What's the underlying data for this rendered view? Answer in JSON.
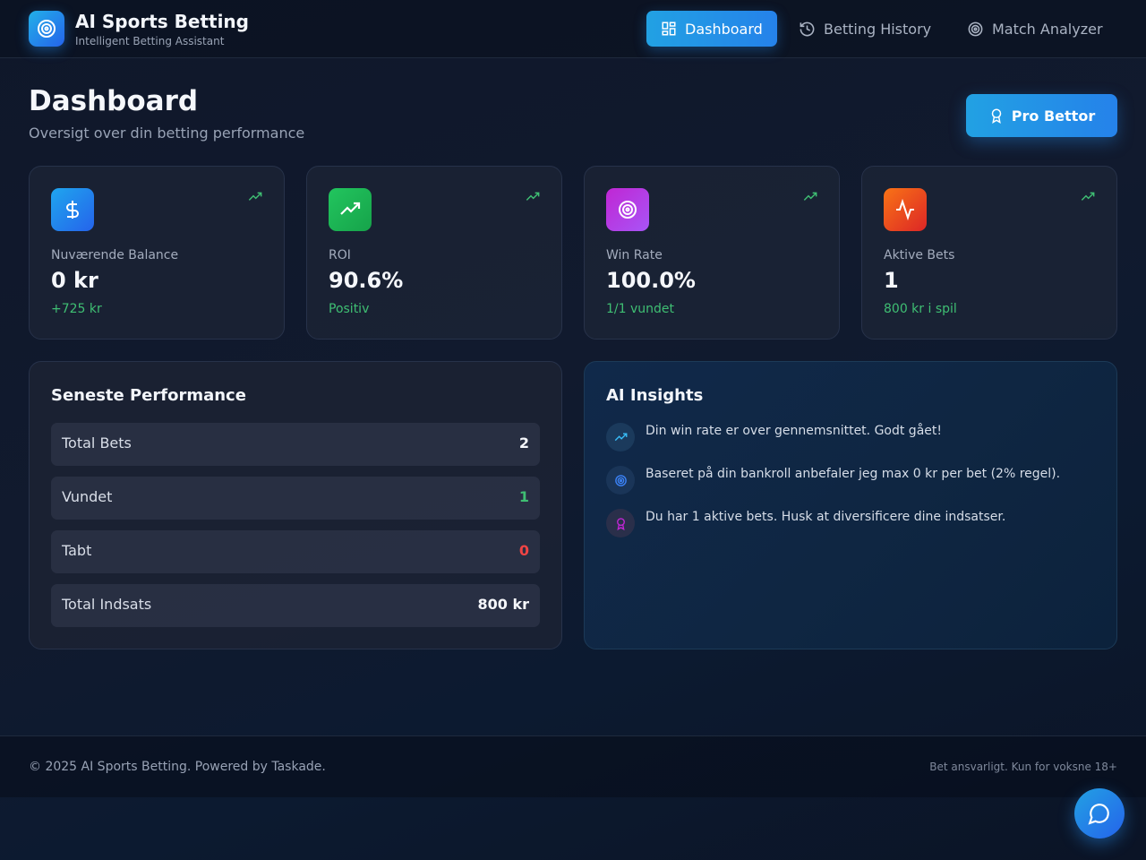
{
  "app": {
    "title": "AI Sports Betting",
    "subtitle": "Intelligent Betting Assistant"
  },
  "nav": [
    {
      "label": "Dashboard",
      "icon": "dashboard-grid-icon",
      "active": true
    },
    {
      "label": "Betting History",
      "icon": "history-icon",
      "active": false
    },
    {
      "label": "Match Analyzer",
      "icon": "target-icon",
      "active": false
    }
  ],
  "page": {
    "title": "Dashboard",
    "subtitle": "Oversigt over din betting performance",
    "badge_label": "Pro Bettor",
    "badge_icon": "award-icon"
  },
  "stats": [
    {
      "label": "Nuværende Balance",
      "value": "0 kr",
      "sub": "+725 kr",
      "icon": "dollar-icon",
      "color": "#2196f3"
    },
    {
      "label": "ROI",
      "value": "90.6%",
      "sub": "Positiv",
      "icon": "trending-up-icon",
      "color": "#22c55e"
    },
    {
      "label": "Win Rate",
      "value": "100.0%",
      "sub": "1/1 vundet",
      "icon": "target-icon",
      "color": "#c026d3"
    },
    {
      "label": "Aktive Bets",
      "value": "1",
      "sub": "800 kr i spil",
      "icon": "activity-icon",
      "color": "#ea580c"
    }
  ],
  "performance": {
    "title": "Seneste Performance",
    "rows": [
      {
        "label": "Total Bets",
        "value": "2",
        "color": "#f5f7fb"
      },
      {
        "label": "Vundet",
        "value": "1",
        "color": "#3fbf73"
      },
      {
        "label": "Tabt",
        "value": "0",
        "color": "#ef4444"
      },
      {
        "label": "Total Indsats",
        "value": "800 kr",
        "color": "#f5f7fb"
      }
    ]
  },
  "insights": {
    "title": "AI Insights",
    "items": [
      {
        "text": "Din win rate er over gennemsnittet. Godt gået!",
        "icon": "trending-up-icon"
      },
      {
        "text": "Baseret på din bankroll anbefaler jeg max 0 kr per bet (2% regel).",
        "icon": "target-icon"
      },
      {
        "text": "Du har 1 aktive bets. Husk at diversificere dine indsatser.",
        "icon": "award-icon"
      }
    ]
  },
  "footer": {
    "left": "© 2025 AI Sports Betting. Powered by Taskade.",
    "right": "Bet ansvarligt. Kun for voksne 18+"
  },
  "colors": {
    "accent": "#2196f3",
    "positive": "#3fbf73",
    "negative": "#ef4444"
  }
}
